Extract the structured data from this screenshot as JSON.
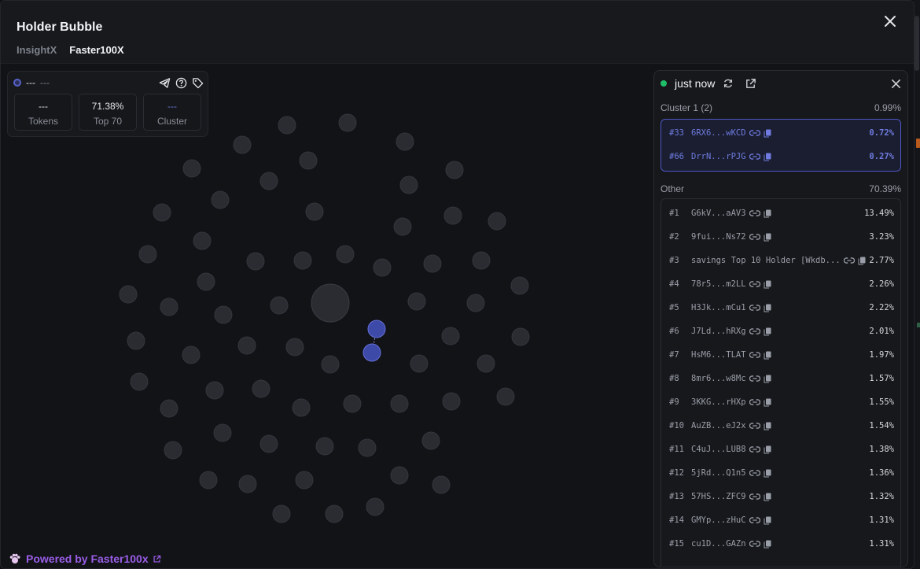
{
  "header": {
    "title": "Holder Bubble",
    "tabs": [
      {
        "label": "InsightX",
        "active": false
      },
      {
        "label": "Faster100X",
        "active": true
      }
    ]
  },
  "token": {
    "name": "---",
    "symbol": "---",
    "stats": [
      {
        "value": "---",
        "label": "Tokens"
      },
      {
        "value": "71.38%",
        "label": "Top 70"
      },
      {
        "value": "---",
        "label": "Cluster"
      }
    ],
    "icons": [
      "telegram-icon",
      "help-icon",
      "tag-icon"
    ]
  },
  "sidebar": {
    "status": "just now",
    "cluster": {
      "title": "Cluster 1 (2)",
      "percent": "0.99%",
      "rows": [
        {
          "rank": "#33",
          "address": "6RX6...wKCD",
          "percent": "0.72%"
        },
        {
          "rank": "#66",
          "address": "DrrN...rPJG",
          "percent": "0.27%"
        }
      ]
    },
    "other": {
      "title": "Other",
      "percent": "70.39%",
      "rows": [
        {
          "rank": "#1",
          "address": "G6kV...aAV3",
          "percent": "13.49%"
        },
        {
          "rank": "#2",
          "address": "9fui...Ns72",
          "percent": "3.23%"
        },
        {
          "rank": "#3",
          "address": "savings Top 10 Holder [Wkdb...",
          "percent": "2.77%"
        },
        {
          "rank": "#4",
          "address": "78r5...m2LL",
          "percent": "2.26%"
        },
        {
          "rank": "#5",
          "address": "H3Jk...mCu1",
          "percent": "2.22%"
        },
        {
          "rank": "#6",
          "address": "J7Ld...hRXg",
          "percent": "2.01%"
        },
        {
          "rank": "#7",
          "address": "HsM6...TLAT",
          "percent": "1.97%"
        },
        {
          "rank": "#8",
          "address": "8mr6...w8Mc",
          "percent": "1.57%"
        },
        {
          "rank": "#9",
          "address": "3KKG...rHXp",
          "percent": "1.55%"
        },
        {
          "rank": "#10",
          "address": "AuZB...eJ2x",
          "percent": "1.54%"
        },
        {
          "rank": "#11",
          "address": "C4uJ...LUB8",
          "percent": "1.38%"
        },
        {
          "rank": "#12",
          "address": "5jRd...Q1n5",
          "percent": "1.36%"
        },
        {
          "rank": "#13",
          "address": "57HS...ZFC9",
          "percent": "1.32%"
        },
        {
          "rank": "#14",
          "address": "GMYp...zHuC",
          "percent": "1.31%"
        },
        {
          "rank": "#15",
          "address": "cu1D...GAZn",
          "percent": "1.31%"
        }
      ]
    }
  },
  "footer": {
    "label": "Powered by Faster100x"
  },
  "colors": {
    "bubble_default": "#2a2c32",
    "bubble_cluster": "#3e4aa8",
    "cluster_outline": "#4d58c4",
    "accent_purple": "#9a5de8",
    "live_green": "#1fbf6a"
  }
}
